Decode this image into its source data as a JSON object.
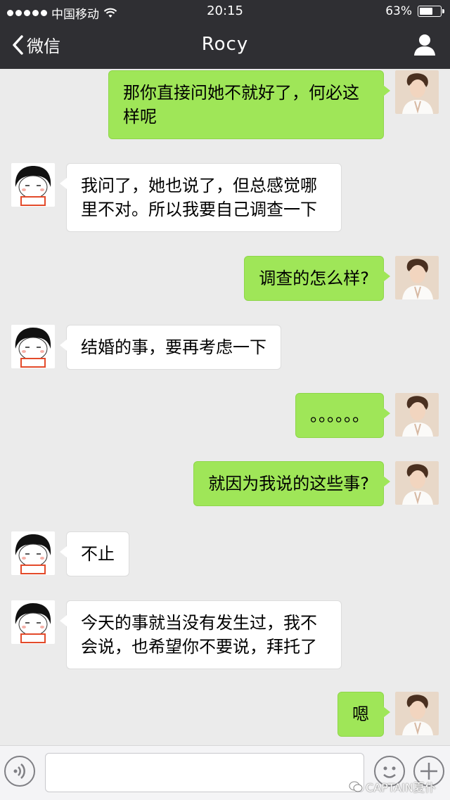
{
  "status_bar": {
    "carrier": "中国移动",
    "time": "20:15",
    "battery_percent": "63%",
    "battery_level": 0.63,
    "signal_icon": "signal-dots-icon",
    "wifi_icon": "wifi-icon"
  },
  "nav": {
    "back_label": "微信",
    "title": "Rocy",
    "back_icon": "chevron-left-icon",
    "profile_icon": "person-icon"
  },
  "colors": {
    "nav_bg": "#2f2f33",
    "chat_bg": "#ebebeb",
    "my_bubble": "#9fe658",
    "their_bubble": "#ffffff"
  },
  "messages": [
    {
      "from": "me",
      "text": "那你直接问她不就好了，何必这样呢"
    },
    {
      "from": "them",
      "text": "我问了，她也说了，但总感觉哪里不对。所以我要自己调查一下"
    },
    {
      "from": "me",
      "text": "调查的怎么样?"
    },
    {
      "from": "them",
      "text": "结婚的事，要再考虑一下"
    },
    {
      "from": "me",
      "text": "。。。。。。"
    },
    {
      "from": "me",
      "text": "就因为我说的这些事?"
    },
    {
      "from": "them",
      "text": "不止"
    },
    {
      "from": "them",
      "text": "今天的事就当没有发生过，我不会说，也希望你不要说，拜托了"
    },
    {
      "from": "me",
      "text": "嗯"
    }
  ],
  "input_bar": {
    "voice_icon": "voice-icon",
    "emoji_icon": "emoji-icon",
    "plus_icon": "plus-icon",
    "watermark": "CAPTAIN夏仆"
  }
}
